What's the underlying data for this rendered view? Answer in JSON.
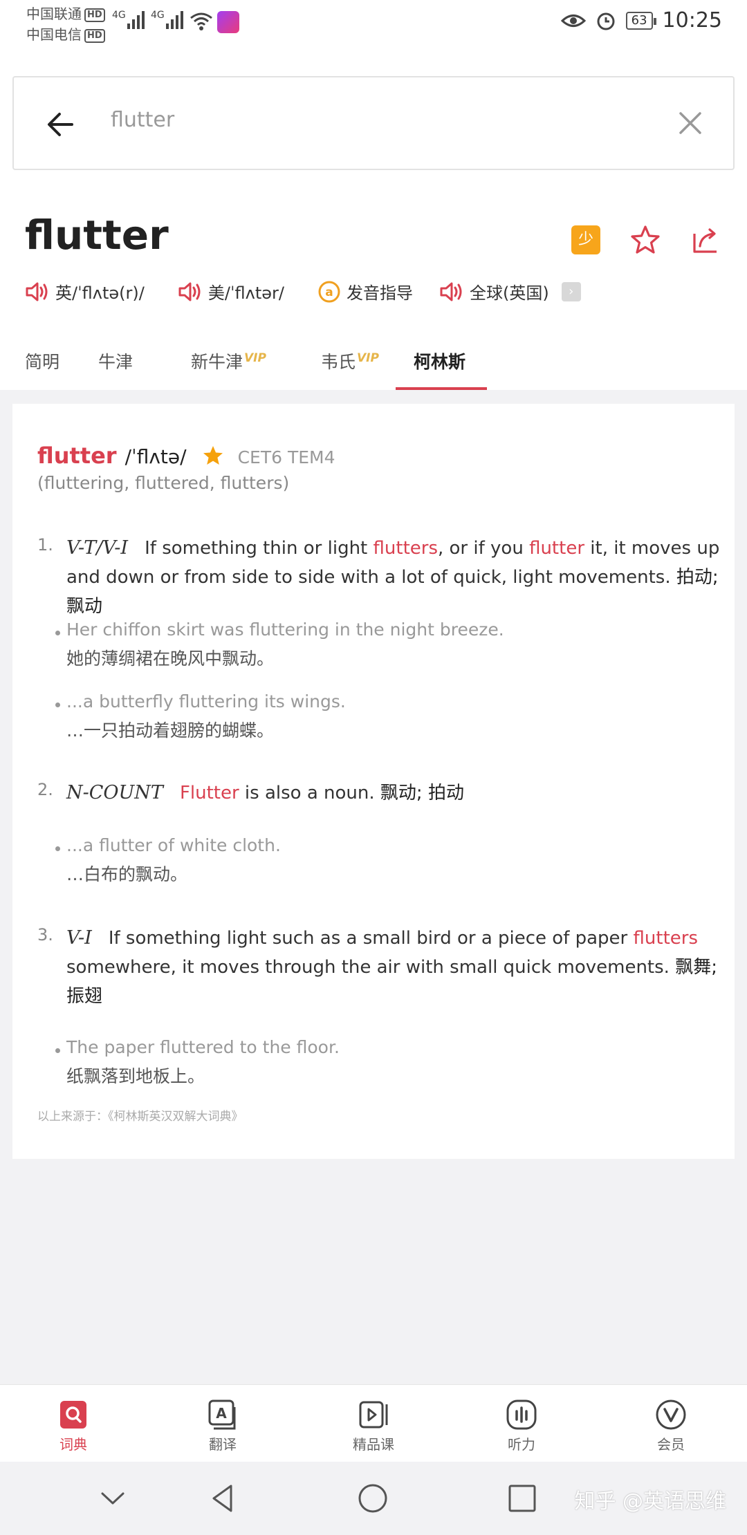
{
  "status_bar": {
    "carrier1": "中国联通",
    "carrier2": "中国电信",
    "hd": "HD",
    "net1": "4G",
    "net2": "4G",
    "battery": "63",
    "time": "10:25"
  },
  "search": {
    "query": "flutter"
  },
  "header": {
    "word": "flutter",
    "pronunciations": [
      {
        "label": "英/ˈflʌtə(r)/"
      },
      {
        "label": "美/ˈflʌtər/"
      },
      {
        "label": "发音指导"
      },
      {
        "label": "全球(英国)"
      }
    ]
  },
  "tabs": [
    {
      "label": "简明"
    },
    {
      "label": "牛津"
    },
    {
      "label": "新牛津",
      "badge": "VIP"
    },
    {
      "label": "韦氏",
      "badge": "VIP"
    },
    {
      "label": "柯林斯",
      "active": true
    }
  ],
  "entry": {
    "word": "flutter",
    "phonetic": "/ˈflʌtə/",
    "level": "CET6 TEM4",
    "forms": "(fluttering, fluttered, flutters)",
    "senses": [
      {
        "num": "1.",
        "gram": "V-T/V-I",
        "p1": "If something thin or light ",
        "h1": "flutters",
        "p2": ", or if you ",
        "h2": "flutter",
        "p3": " it, it moves up and down or from side to side with a lot of quick, light movements.",
        "zh": " 拍动; 飘动",
        "examples": [
          {
            "en": "Her chiffon skirt was fluttering in the night breeze.",
            "cn": "她的薄绸裙在晚风中飘动。"
          },
          {
            "en": "...a butterfly fluttering its wings.",
            "cn": "…一只拍动着翅膀的蝴蝶。"
          }
        ]
      },
      {
        "num": "2.",
        "gram": "N-COUNT",
        "h1": "Flutter",
        "p1": " is also a noun.",
        "zh": " 飘动; 拍动",
        "examples": [
          {
            "en": "...a flutter of white cloth.",
            "cn": "…白布的飘动。"
          }
        ]
      },
      {
        "num": "3.",
        "gram": "V-I",
        "p1": "If something light such as a small bird or a piece of paper ",
        "h1": "flutters",
        "p2": " somewhere, it moves through the air with small quick movements.",
        "zh": " 飘舞; 振翅",
        "examples": [
          {
            "en": "The paper fluttered to the floor.",
            "cn": "纸飘落到地板上。"
          }
        ]
      }
    ],
    "source": "以上来源于：《柯林斯英汉双解大词典》"
  },
  "bottom_nav": [
    {
      "label": "词典",
      "icon": "dictionary-icon",
      "active": true
    },
    {
      "label": "翻译",
      "icon": "translate-icon"
    },
    {
      "label": "精品课",
      "icon": "course-icon"
    },
    {
      "label": "听力",
      "icon": "listening-icon"
    },
    {
      "label": "会员",
      "icon": "vip-icon"
    }
  ],
  "watermark": "知乎 @英语思维",
  "colors": {
    "accent": "#d9404f",
    "star": "#f5a10c",
    "vip": "#e6b54a"
  }
}
